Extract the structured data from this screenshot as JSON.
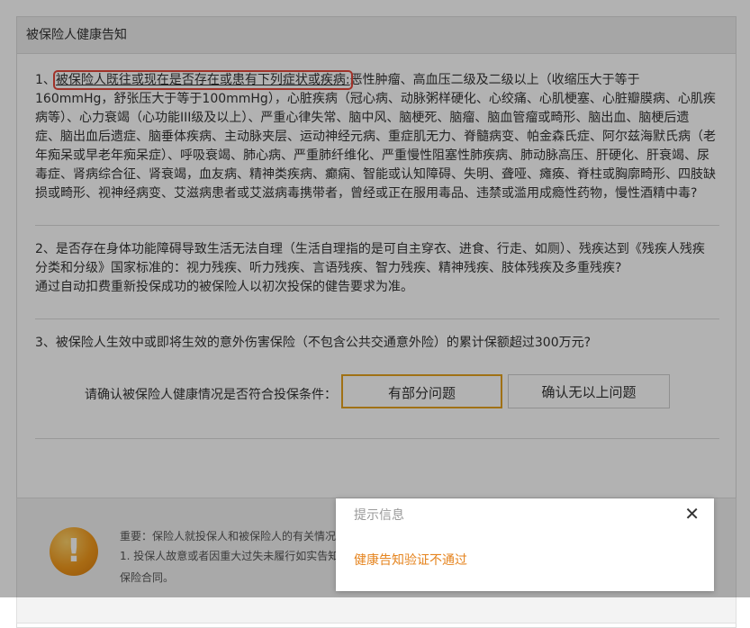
{
  "panel": {
    "title": "被保险人健康告知"
  },
  "questions": {
    "q1_prefix": "1、",
    "q1_highlight": "被保险人既往或现在是否存在或患有下列症状或疾病:",
    "q1_line1_rest": "恶性肿瘤、高血压二级及二级以上（收缩压大于等于",
    "q1_line2": "160mmHg，舒张压大于等于100mmHg），心脏疾病（冠心病、动脉粥样硬化、心绞痛、心肌梗塞、心脏瓣膜病、心肌疾",
    "q1_line3": "病等）、心力衰竭（心功能III级及以上）、严重心律失常、脑中风、脑梗死、脑瘤、脑血管瘤或畸形、脑出血、脑梗后遗",
    "q1_line4": "症、脑出血后遗症、脑垂体疾病、主动脉夹层、运动神经元病、重症肌无力、脊髓病变、帕金森氏症、阿尔兹海默氏病（老",
    "q1_line5": "年痴呆或早老年痴呆症）、呼吸衰竭、肺心病、严重肺纤维化、严重慢性阻塞性肺疾病、肺动脉高压、肝硬化、肝衰竭、尿",
    "q1_line6": "毒症、肾病综合征、肾衰竭，血友病、精神类疾病、癫痫、智能或认知障碍、失明、聋哑、瘫痪、脊柱或胸廓畸形、四肢缺",
    "q1_line7": "损或畸形、视神经病变、艾滋病患者或艾滋病毒携带者，曾经或正在服用毒品、违禁或滥用成瘾性药物，慢性酒精中毒?",
    "q2_line1": "2、是否存在身体功能障碍导致生活无法自理（生活自理指的是可自主穿衣、进食、行走、如厕）、残疾达到《残疾人残疾",
    "q2_line2": "分类和分级》国家标准的：视力残疾、听力残疾、言语残疾、智力残疾、精神残疾、肢体残疾及多重残疾?",
    "q2_line3": "通过自动扣费重新投保成功的被保险人以初次投保的健告要求为准。",
    "q3_line1": "3、被保险人生效中或即将生效的意外伤害保险（不包含公共交通意外险）的累计保额超过300万元?"
  },
  "confirm": {
    "label": "请确认被保险人健康情况是否符合投保条件：",
    "partial_button": "有部分问题",
    "none_button": "确认无以上问题"
  },
  "notice": {
    "icon": "warning-icon",
    "line1": "重要：保险人就投保人和被保险人的有关情况",
    "line2": "1. 投保人故意或者因重大过失未履行如实告知",
    "line3": "保险合同。"
  },
  "dialog": {
    "title": "提示信息",
    "close_icon": "close-icon",
    "message": "健康告知验证不通过"
  },
  "colors": {
    "highlight_border": "#e5483b",
    "accent_orange": "#e5a21f",
    "message_orange": "#e5831d"
  }
}
